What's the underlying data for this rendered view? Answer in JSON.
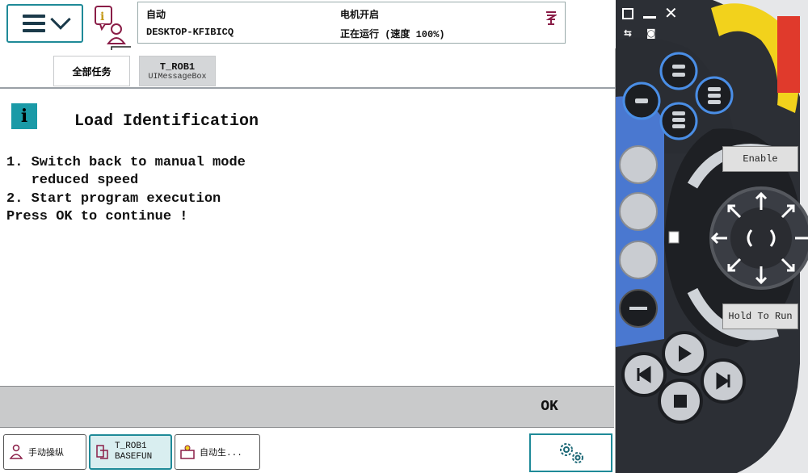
{
  "header": {
    "mode": "自动",
    "hostname": "DESKTOP-KFIBICQ",
    "motors": "电机开启",
    "run_state": "正在运行 (速度 100%)"
  },
  "tabs": [
    {
      "label": "全部任务",
      "sub": ""
    },
    {
      "label": "T_ROB1",
      "sub": "UIMessageBox"
    }
  ],
  "message": {
    "icon_letter": "i",
    "title": "Load Identification",
    "lines": [
      "1. Switch back to manual mode",
      "   reduced speed",
      "2. Start program execution",
      "Press OK to continue !"
    ]
  },
  "ok_label": "OK",
  "taskbar": {
    "jog": "手动操纵",
    "rob_line1": "T_ROB1",
    "rob_line2": "BASEFUN",
    "auto": "自动生..."
  },
  "pendant": {
    "enable_label": "Enable",
    "hold_label": "Hold To Run"
  },
  "colors": {
    "accent_teal": "#1a9aa7",
    "pendant_blue": "#4a78d0",
    "pendant_dark": "#2a2d33",
    "stop_yellow": "#f2d21c",
    "stop_red": "#e03a2c"
  }
}
